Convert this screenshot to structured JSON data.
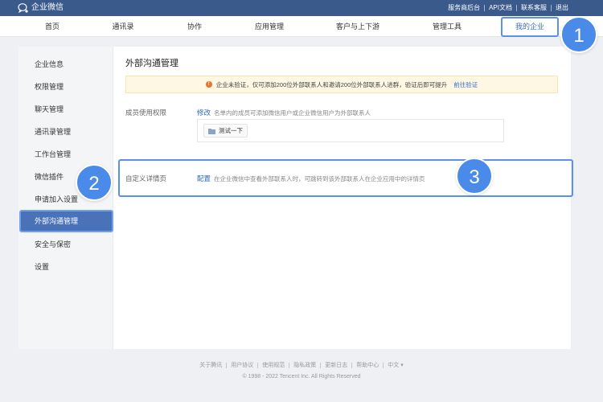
{
  "topbar": {
    "app_name": "企业微信",
    "links": [
      "服务商后台",
      "API文档",
      "联系客服",
      "退出"
    ],
    "bg_color": "#3a5a8c"
  },
  "nav": {
    "items": [
      "首页",
      "通讯录",
      "协作",
      "应用管理",
      "客户与上下游",
      "管理工具",
      "我的企业"
    ],
    "active": "我的企业"
  },
  "sidebar": {
    "items": [
      "企业信息",
      "权限管理",
      "聊天管理",
      "通讯录管理",
      "工作台管理",
      "微信插件",
      "申请加入设置",
      "外部沟通管理",
      "安全与保密",
      "设置"
    ],
    "active": "外部沟通管理"
  },
  "main": {
    "title": "外部沟通管理",
    "warning": {
      "text": "企业未验证，仅可添加200位外部联系人和邀请200位外部联系人进群，验证后即可提升",
      "link": "前往验证"
    },
    "member_permission": {
      "label": "成员使用权限",
      "link": "修改",
      "description": "名单内的成员可添加微信用户或企业微信用户为外部联系人",
      "chip": "测试一下"
    },
    "custom_detail": {
      "label": "自定义详情页",
      "link": "配置",
      "description": "在企业微信中查看外部联系人时，可跳转到该外部联系人在企业应用中的详情页"
    }
  },
  "annotations": {
    "badges": [
      "1",
      "2",
      "3"
    ],
    "color": "#4a8be9"
  },
  "footer": {
    "links": [
      "关于腾讯",
      "用户协议",
      "使用规范",
      "隐私政策",
      "更新日志",
      "帮助中心",
      "中文 ▾"
    ],
    "copyright": "© 1998 - 2022 Tencent Inc. All Rights Reserved"
  }
}
